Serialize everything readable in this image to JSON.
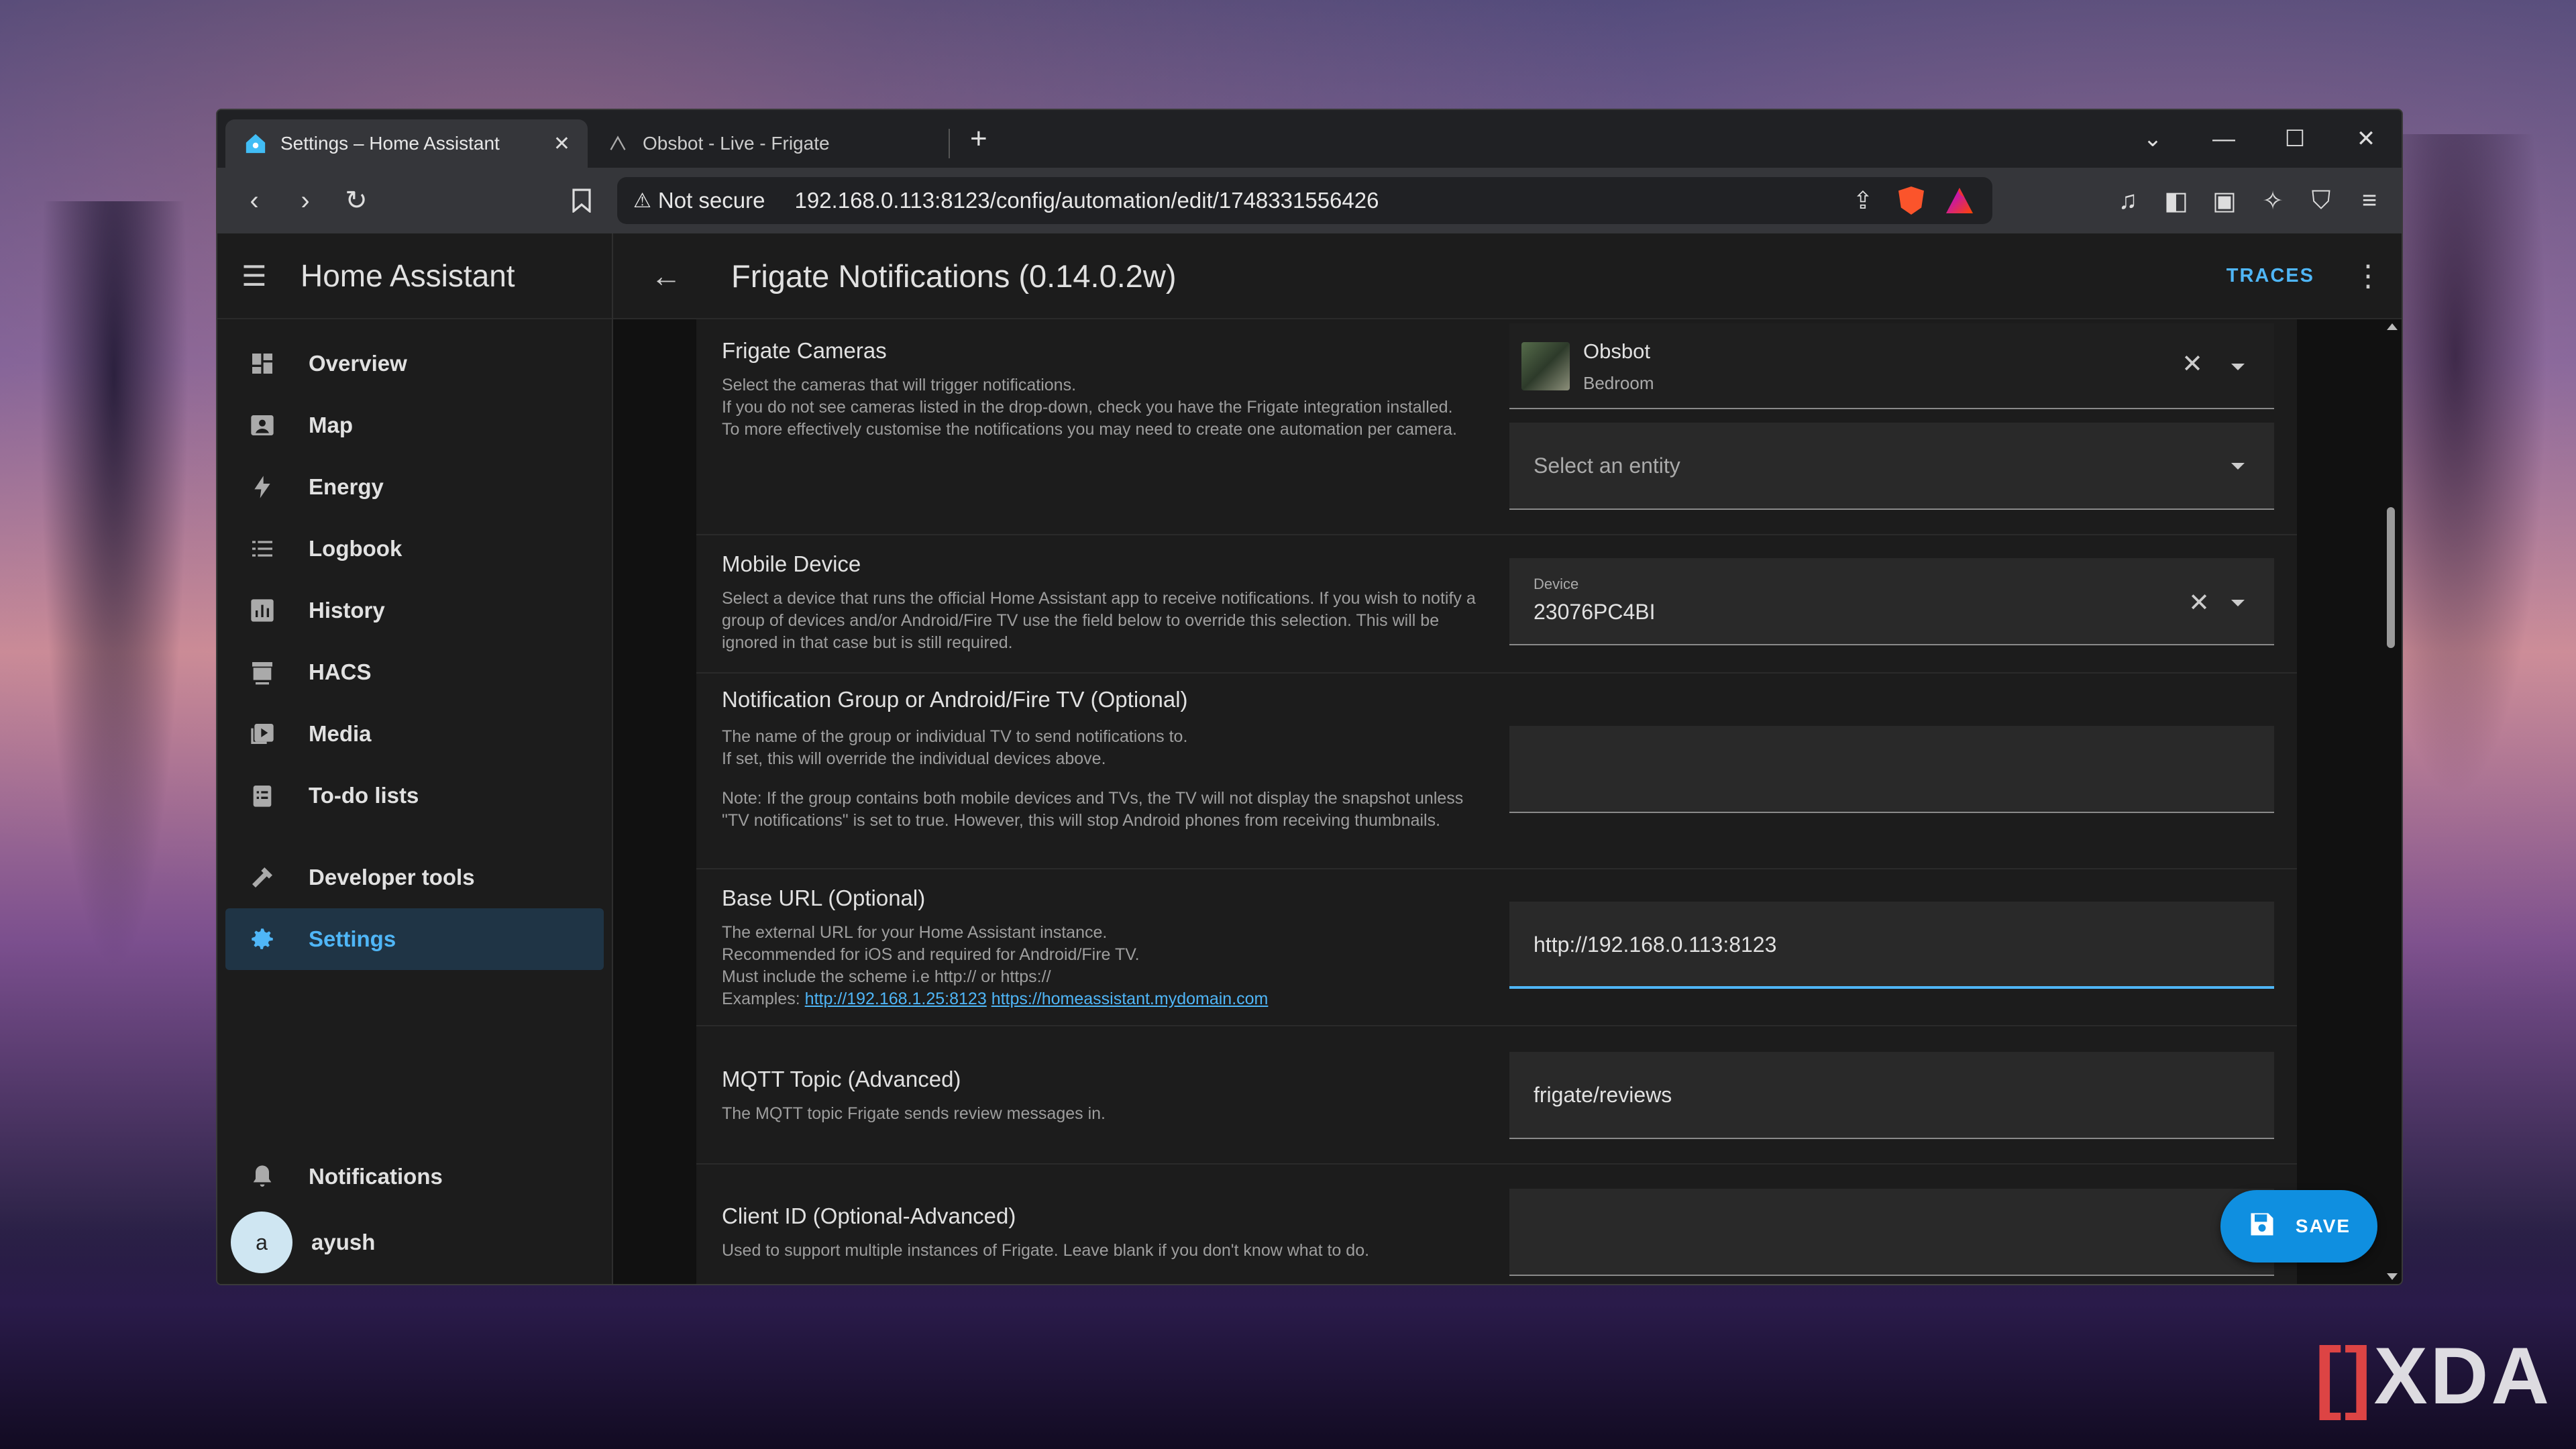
{
  "browser": {
    "tabs": [
      {
        "title": "Settings – Home Assistant",
        "active": true
      },
      {
        "title": "Obsbot - Live - Frigate",
        "active": false
      }
    ],
    "address": {
      "security_label": "Not secure",
      "url": "192.168.0.113:8123/config/automation/edit/1748331556426"
    },
    "rewards_badge": "1"
  },
  "sidebar": {
    "app_name": "Home Assistant",
    "items": [
      {
        "label": "Overview",
        "icon": "dashboard-icon"
      },
      {
        "label": "Map",
        "icon": "map-icon"
      },
      {
        "label": "Energy",
        "icon": "energy-icon"
      },
      {
        "label": "Logbook",
        "icon": "logbook-icon"
      },
      {
        "label": "History",
        "icon": "history-icon"
      },
      {
        "label": "HACS",
        "icon": "hacs-icon"
      },
      {
        "label": "Media",
        "icon": "media-icon"
      },
      {
        "label": "To-do lists",
        "icon": "todo-icon"
      },
      {
        "label": "Developer tools",
        "icon": "hammer-icon"
      },
      {
        "label": "Settings",
        "icon": "gear-icon",
        "active": true
      }
    ],
    "notifications_label": "Notifications",
    "user": {
      "name": "ayush",
      "initial": "a"
    }
  },
  "header": {
    "title": "Frigate Notifications (0.14.0.2w)",
    "traces_label": "TRACES"
  },
  "form": {
    "cameras": {
      "label": "Frigate Cameras",
      "desc1": "Select the cameras that will trigger notifications.",
      "desc2": "If you do not see cameras listed in the drop-down, check you have the Frigate integration installed.",
      "desc3": "To more effectively customise the notifications you may need to create one automation per camera.",
      "selected_name": "Obsbot",
      "selected_area": "Bedroom",
      "entity_placeholder": "Select an entity"
    },
    "mobile": {
      "label": "Mobile Device",
      "desc": "Select a device that runs the official Home Assistant app to receive notifications. If you wish to notify a group of devices and/or Android/Fire TV use the field below to override this selection. This will be ignored in that case but is still required.",
      "field_label": "Device",
      "value": "23076PC4BI"
    },
    "group": {
      "label": "Notification Group or Android/Fire TV (Optional)",
      "desc1": "The name of the group or individual TV to send notifications to.",
      "desc2": "If set, this will override the individual devices above.",
      "desc3": "Note: If the group contains both mobile devices and TVs, the TV will not display the snapshot unless \"TV notifications\" is set to true. However, this will stop Android phones from receiving thumbnails.",
      "value": ""
    },
    "base_url": {
      "label": "Base URL (Optional)",
      "desc1": "The external URL for your Home Assistant instance.",
      "desc2": "Recommended for iOS and required for Android/Fire TV.",
      "desc3": "Must include the scheme i.e http:// or https://",
      "examples_prefix": "Examples: ",
      "example1": "http://192.168.1.25:8123",
      "example2": "https://homeassistant.mydomain.com",
      "value": "http://192.168.0.113:8123"
    },
    "mqtt": {
      "label": "MQTT Topic (Advanced)",
      "desc": "The MQTT topic Frigate sends review messages in.",
      "value": "frigate/reviews"
    },
    "client_id": {
      "label": "Client ID (Optional-Advanced)",
      "desc": "Used to support multiple instances of Frigate. Leave blank if you don't know what to do.",
      "value": ""
    }
  },
  "save_label": "SAVE",
  "watermark": "XDA",
  "colors": {
    "accent": "#4fb6f7",
    "fab": "#0f8fe0",
    "card": "#1c1c1c"
  }
}
